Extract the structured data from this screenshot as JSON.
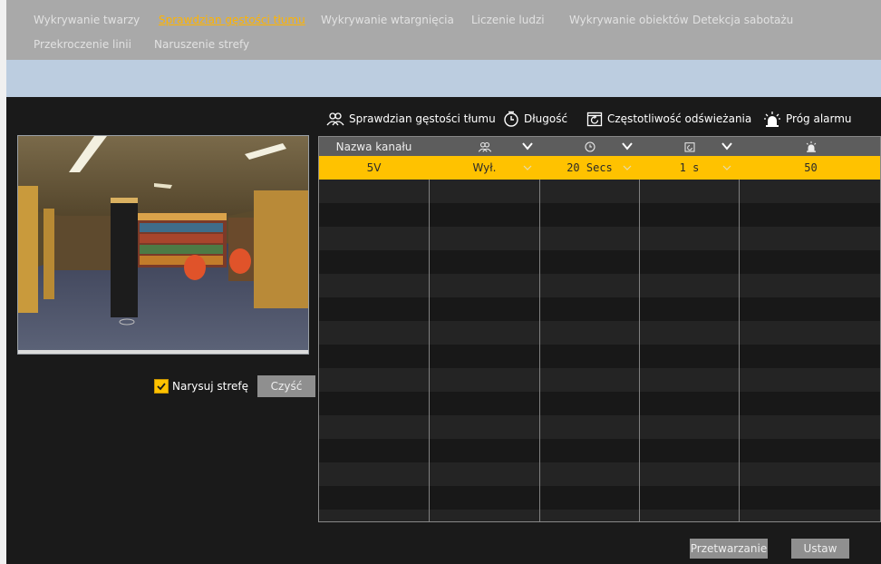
{
  "tabs": [
    {
      "label": "Wykrywanie twarzy",
      "active": false
    },
    {
      "label": "Sprawdzian gęstości tłumu",
      "active": true
    },
    {
      "label": "Wykrywanie wtargnięcia",
      "active": false
    },
    {
      "label": "Liczenie ludzi",
      "active": false
    },
    {
      "label": "Wykrywanie obiektów",
      "active": false
    },
    {
      "label": "Detekcja sabotażu",
      "active": false
    },
    {
      "label": "Przekroczenie linii",
      "active": false
    },
    {
      "label": "Naruszenie strefy",
      "active": false
    }
  ],
  "legend": {
    "crowd": "Sprawdzian gęstości tłumu",
    "duration": "Długość",
    "refresh": "Częstotliwość odświeżania",
    "alarm": "Próg alarmu"
  },
  "table": {
    "header": {
      "channel": "Nazwa kanału"
    },
    "row": {
      "channel": "5V",
      "crowd": "Wył.",
      "duration": "20 Secs",
      "refresh": "1 s",
      "alarm": "50"
    }
  },
  "draw_zone": {
    "label": "Narysuj strefę",
    "checked": true
  },
  "buttons": {
    "clear": "Czyść",
    "process": "Przetwarzanie",
    "set": "Ustaw"
  },
  "colors": {
    "accent": "#ffc200",
    "active_tab": "#ffb400"
  }
}
